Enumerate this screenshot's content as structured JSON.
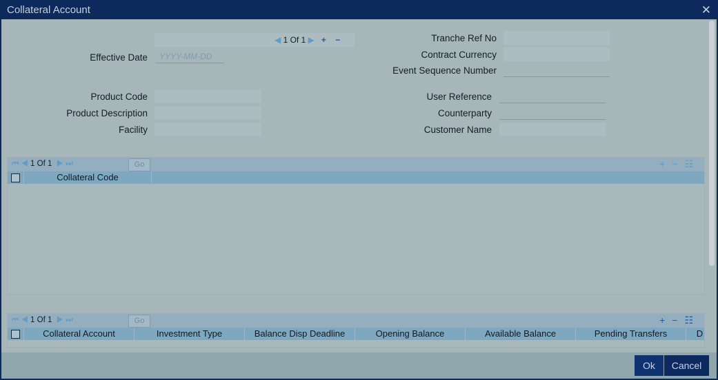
{
  "window": {
    "title": "Collateral Account"
  },
  "header_nav": {
    "page": "1 Of 1"
  },
  "fields": {
    "effective_date": {
      "label": "Effective Date",
      "placeholder": "YYYY-MM-DD"
    },
    "tranche_ref_no": {
      "label": "Tranche Ref No",
      "value": ""
    },
    "contract_currency": {
      "label": "Contract Currency",
      "value": ""
    },
    "event_sequence_number": {
      "label": "Event Sequence Number",
      "value": ""
    },
    "product_code": {
      "label": "Product Code",
      "value": ""
    },
    "product_description": {
      "label": "Product Description",
      "value": ""
    },
    "facility": {
      "label": "Facility",
      "value": ""
    },
    "user_reference": {
      "label": "User Reference",
      "value": ""
    },
    "counterparty": {
      "label": "Counterparty",
      "value": ""
    },
    "customer_name": {
      "label": "Customer Name",
      "value": ""
    }
  },
  "grid1": {
    "page": "1 Of 1",
    "go": "Go",
    "columns": [
      "Collateral Code"
    ]
  },
  "grid2": {
    "page": "1 Of 1",
    "go": "Go",
    "columns": [
      "Collateral Account",
      "Investment Type",
      "Balance Disp Deadline",
      "Opening Balance",
      "Available Balance",
      "Pending Transfers",
      "D"
    ]
  },
  "buttons": {
    "ok": "Ok",
    "cancel": "Cancel"
  }
}
